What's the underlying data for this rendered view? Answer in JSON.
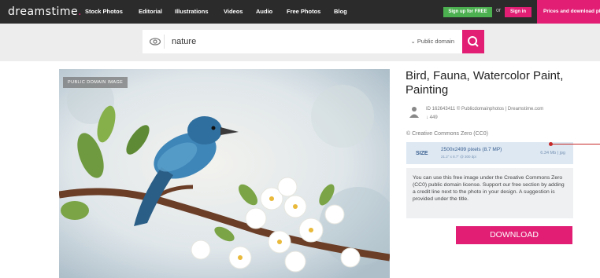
{
  "header": {
    "logo": "dreamstime",
    "nav": [
      "Stock Photos",
      "Editorial",
      "Illustrations",
      "Videos",
      "Audio",
      "Free Photos",
      "Blog"
    ],
    "signup": "Sign up for FREE",
    "or": "or",
    "signin": "Sign in",
    "pricing": "Prices and download plans"
  },
  "search": {
    "query": "nature",
    "filter": "Public domain"
  },
  "image": {
    "badge": "PUBLIC DOMAIN IMAGE"
  },
  "details": {
    "title": "Bird, Fauna, Watercolor Paint, Painting",
    "id_line": "ID 162643411 © Publicdomainphotos | Dreamstime.com",
    "count": "449",
    "license": "Creative Commons Zero (CC0)",
    "size_label": "SIZE",
    "size_main": "2500x2499 pixels (8.7 MP)",
    "size_sub": "21.2\" x 8.7\" @ 300 dpi",
    "size_file": "6.34 Mb | jpg",
    "info": "You can use this free image under the Creative Commons Zero (CC0) public domain license. Support our free section by adding a credit line next to the photo in your design. A suggestion is provided under the title.",
    "download": "DOWNLOAD"
  },
  "colors": {
    "brand": "#e11d74",
    "topbar": "#2b2b2b",
    "signup": "#4caf50",
    "sizebox": "#dde8f3"
  }
}
